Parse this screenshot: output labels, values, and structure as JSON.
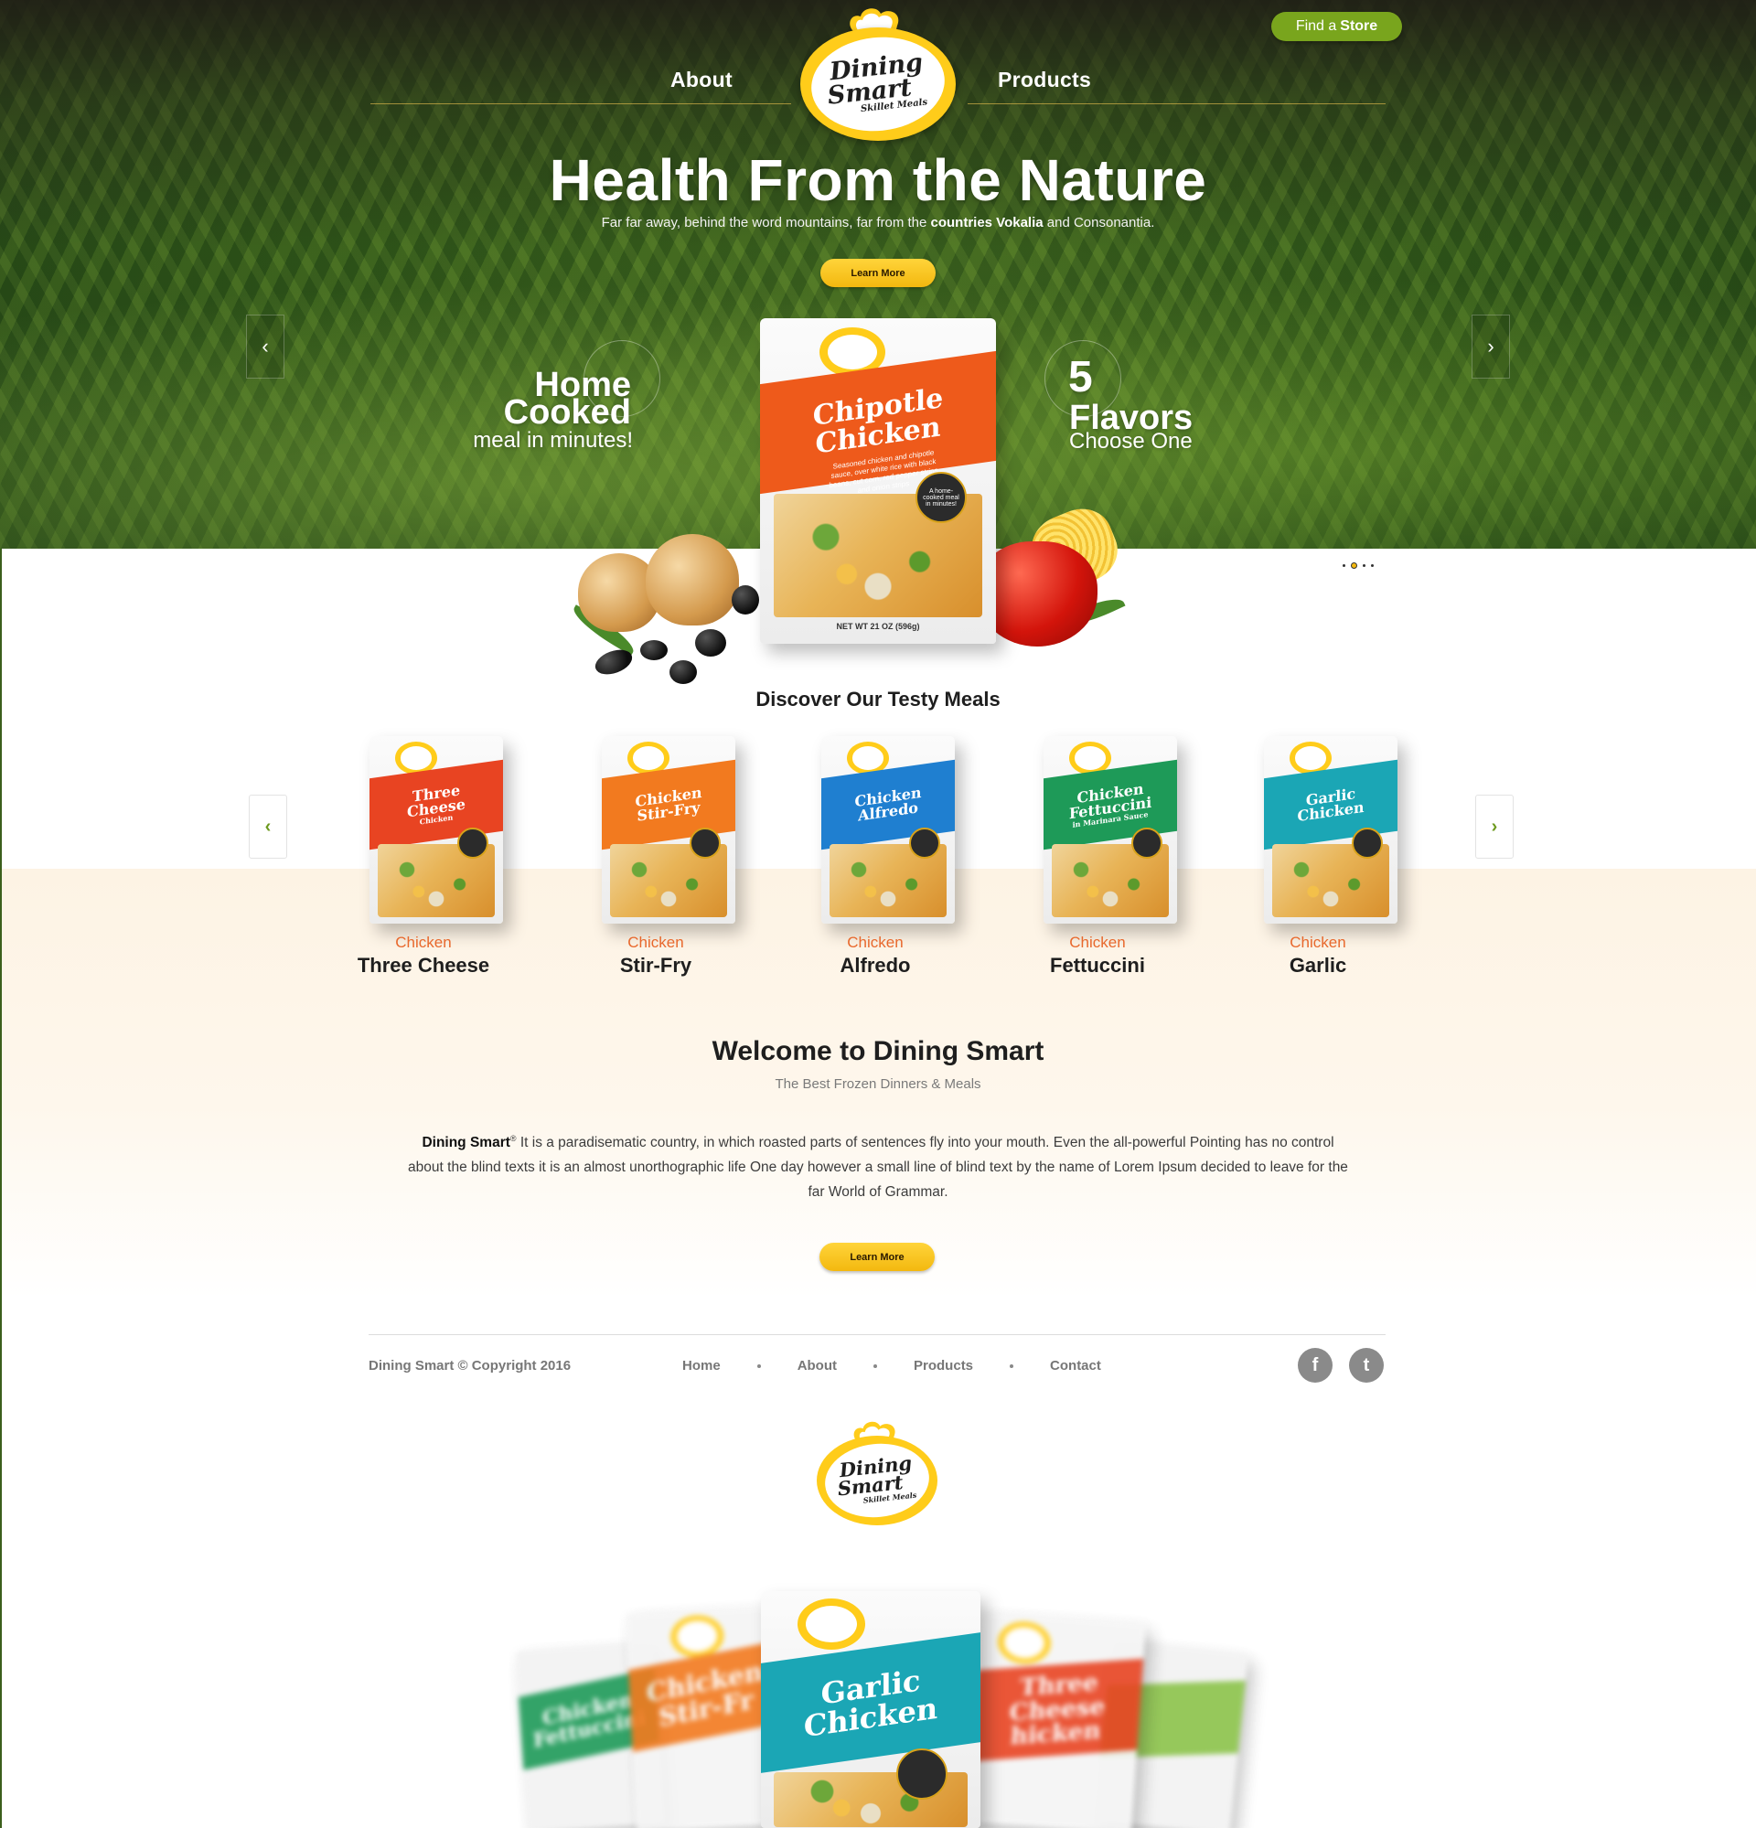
{
  "header": {
    "find_store_prefix": "Find a",
    "find_store_bold": "Store",
    "nav_left": "About",
    "nav_right": "Products"
  },
  "logo": {
    "line1": "Dining",
    "line2": "Smart",
    "line3": "Skillet Meals"
  },
  "hero": {
    "title": "Health From the Nature",
    "subtitle_before": "Far far away, behind the word mountains, far from the ",
    "subtitle_bold": "countries Vokalia",
    "subtitle_after": " and Consonantia.",
    "button_label": "Learn More",
    "left_feature": {
      "line1": "Home",
      "line2": "Cooked",
      "line3": "meal in minutes!"
    },
    "right_feature": {
      "number": "5",
      "line1": "Flavors",
      "line2": "Choose One"
    },
    "prev_icon": "chevron-left-icon",
    "next_icon": "chevron-right-icon",
    "prev_glyph": "‹",
    "next_glyph": "›",
    "slides_total": 4,
    "slide_active": 2
  },
  "featured_bag": {
    "title_line1": "Chipotle",
    "title_line2": "Chicken",
    "description": "Seasoned chicken and chipotle sauce, over white rice with black beans, cut corn, red pepper strips and onion strips",
    "badge": "A home-cooked meal in minutes!",
    "weight": "NET WT 21 OZ (596g)",
    "band_color": "#ee5a1b"
  },
  "discover": {
    "title": "Discover Our Testy Meals",
    "prev_glyph": "‹",
    "next_glyph": "›",
    "meals": [
      {
        "kicker": "Chicken",
        "name": "Three Cheese",
        "bag_line1": "Three",
        "bag_line2": "Cheese",
        "bag_line3": "Chicken",
        "color": "#e84422"
      },
      {
        "kicker": "Chicken",
        "name": "Stir-Fry",
        "bag_line1": "Chicken",
        "bag_line2": "Stir-Fry",
        "bag_line3": "",
        "color": "#f27a1f"
      },
      {
        "kicker": "Chicken",
        "name": "Alfredo",
        "bag_line1": "Chicken",
        "bag_line2": "Alfredo",
        "bag_line3": "",
        "color": "#1f7fd0"
      },
      {
        "kicker": "Chicken",
        "name": "Fettuccini",
        "bag_line1": "Chicken",
        "bag_line2": "Fettuccini",
        "bag_line3": "in Marinara Sauce",
        "color": "#1e9a58"
      },
      {
        "kicker": "Chicken",
        "name": "Garlic",
        "bag_line1": "Garlic",
        "bag_line2": "Chicken",
        "bag_line3": "",
        "color": "#1ba6b5"
      }
    ]
  },
  "welcome": {
    "title": "Welcome to  Dining Smart",
    "subtitle": "The Best Frozen Dinners & Meals",
    "brand": "Dining Smart",
    "reg": "®",
    "body": " It is a paradisematic country, in which roasted parts of sentences fly into your mouth. Even the all-powerful Pointing has no control about the blind texts it is an almost unorthographic life One day however a small line of blind text by the name of Lorem Ipsum decided to leave for the far World of Grammar.",
    "button_label": "Learn More"
  },
  "footer": {
    "copyright": "Dining Smart © Copyright 2016",
    "nav": [
      "Home",
      "About",
      "Products",
      "Contact"
    ],
    "facebook_glyph": "f",
    "twitter_glyph": "t"
  },
  "showcase": {
    "center_line1": "Garlic",
    "center_line2": "Chicken",
    "left_line1": "Chicken",
    "left_line2": "Stir-Fr",
    "far_left_line1": "Chicken",
    "far_left_line2": "Fettuccini",
    "right_line1": "Three",
    "right_line2": "Cheese",
    "right_line3": "hicken"
  },
  "colors": {
    "accent_green": "#79a51d",
    "accent_yellow": "#ffcc1a",
    "accent_orange": "#e8682c"
  }
}
